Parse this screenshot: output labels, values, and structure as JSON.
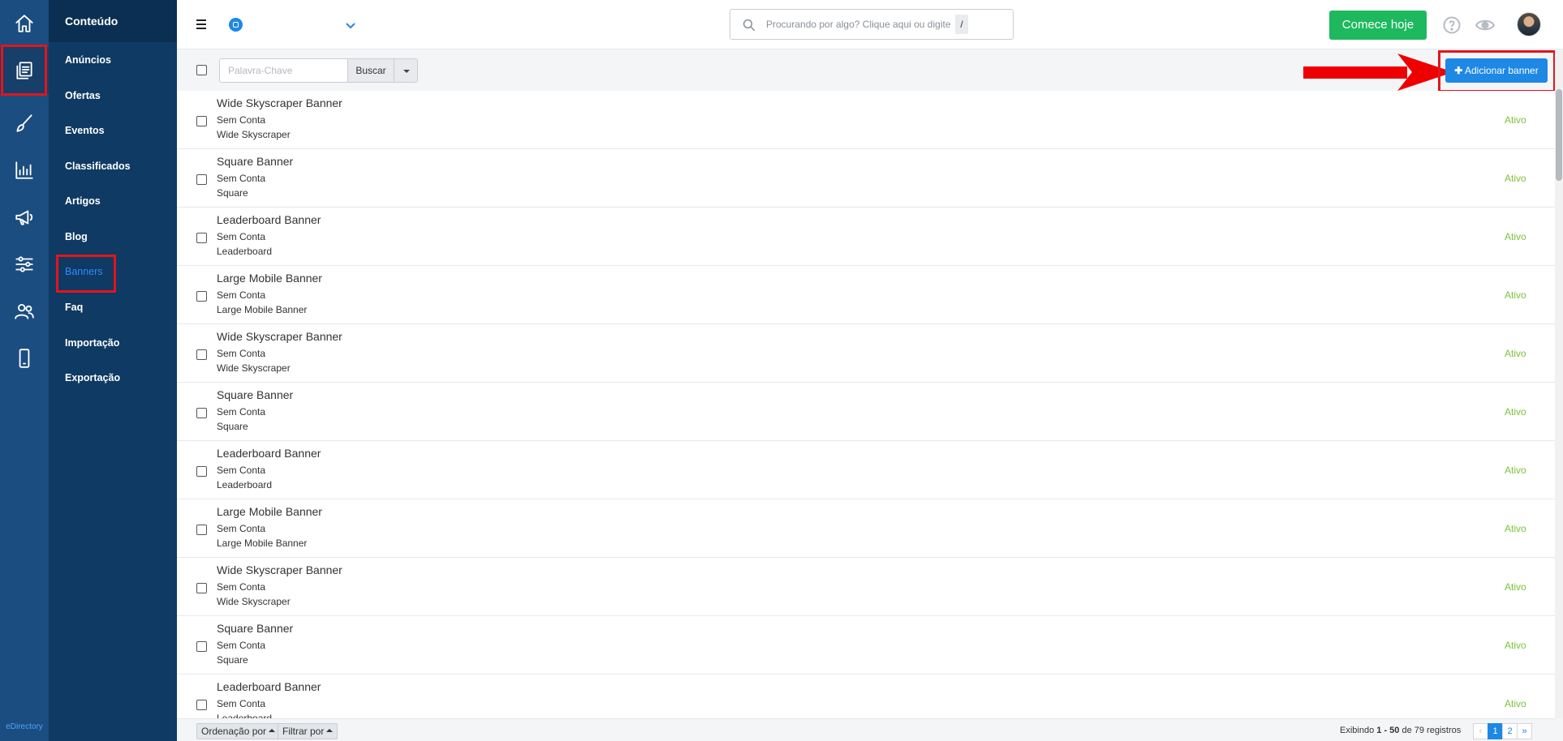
{
  "rail": {
    "brand": "eDirectory",
    "icons": [
      "home-icon",
      "content-icon",
      "design-icon",
      "reports-icon",
      "promote-icon",
      "settings-icon",
      "users-icon",
      "mobile-icon"
    ]
  },
  "subnav": {
    "title": "Conteúdo",
    "items": [
      "Anúncios",
      "Ofertas",
      "Eventos",
      "Classificados",
      "Artigos",
      "Blog",
      "Banners",
      "Faq",
      "Importação",
      "Exportação"
    ],
    "active": "Banners"
  },
  "topbar": {
    "search_placeholder": "Procurando por algo? Clique aqui ou digite",
    "search_shortcut": "/",
    "cta_label": "Comece hoje"
  },
  "toolbar": {
    "keyword_placeholder": "Palavra-Chave",
    "search_label": "Buscar",
    "add_label": "Adicionar banner"
  },
  "banners": [
    {
      "title": "Wide Skyscraper Banner",
      "owner": "Sem Conta",
      "type": "Wide Skyscraper",
      "status": "Ativo"
    },
    {
      "title": "Square Banner",
      "owner": "Sem Conta",
      "type": "Square",
      "status": "Ativo"
    },
    {
      "title": "Leaderboard Banner",
      "owner": "Sem Conta",
      "type": "Leaderboard",
      "status": "Ativo"
    },
    {
      "title": "Large Mobile Banner",
      "owner": "Sem Conta",
      "type": "Large Mobile Banner",
      "status": "Ativo"
    },
    {
      "title": "Wide Skyscraper Banner",
      "owner": "Sem Conta",
      "type": "Wide Skyscraper",
      "status": "Ativo"
    },
    {
      "title": "Square Banner",
      "owner": "Sem Conta",
      "type": "Square",
      "status": "Ativo"
    },
    {
      "title": "Leaderboard Banner",
      "owner": "Sem Conta",
      "type": "Leaderboard",
      "status": "Ativo"
    },
    {
      "title": "Large Mobile Banner",
      "owner": "Sem Conta",
      "type": "Large Mobile Banner",
      "status": "Ativo"
    },
    {
      "title": "Wide Skyscraper Banner",
      "owner": "Sem Conta",
      "type": "Wide Skyscraper",
      "status": "Ativo"
    },
    {
      "title": "Square Banner",
      "owner": "Sem Conta",
      "type": "Square",
      "status": "Ativo"
    },
    {
      "title": "Leaderboard Banner",
      "owner": "Sem Conta",
      "type": "Leaderboard",
      "status": "Ativo"
    }
  ],
  "footer": {
    "sort_label": "Ordenação por",
    "filter_label": "Filtrar por",
    "records_prefix": "Exibindo",
    "records_range": "1 - 50",
    "records_suffix": "de 79 registros",
    "pages": [
      "‹",
      "1",
      "2",
      "»"
    ],
    "current_page": "1"
  },
  "colors": {
    "rail": "#1b4d80",
    "subnav": "#0f3a63",
    "accent": "#1e88e5",
    "cta": "#1eb95e",
    "status_active": "#7cc23a",
    "highlight": "#e3141b"
  }
}
